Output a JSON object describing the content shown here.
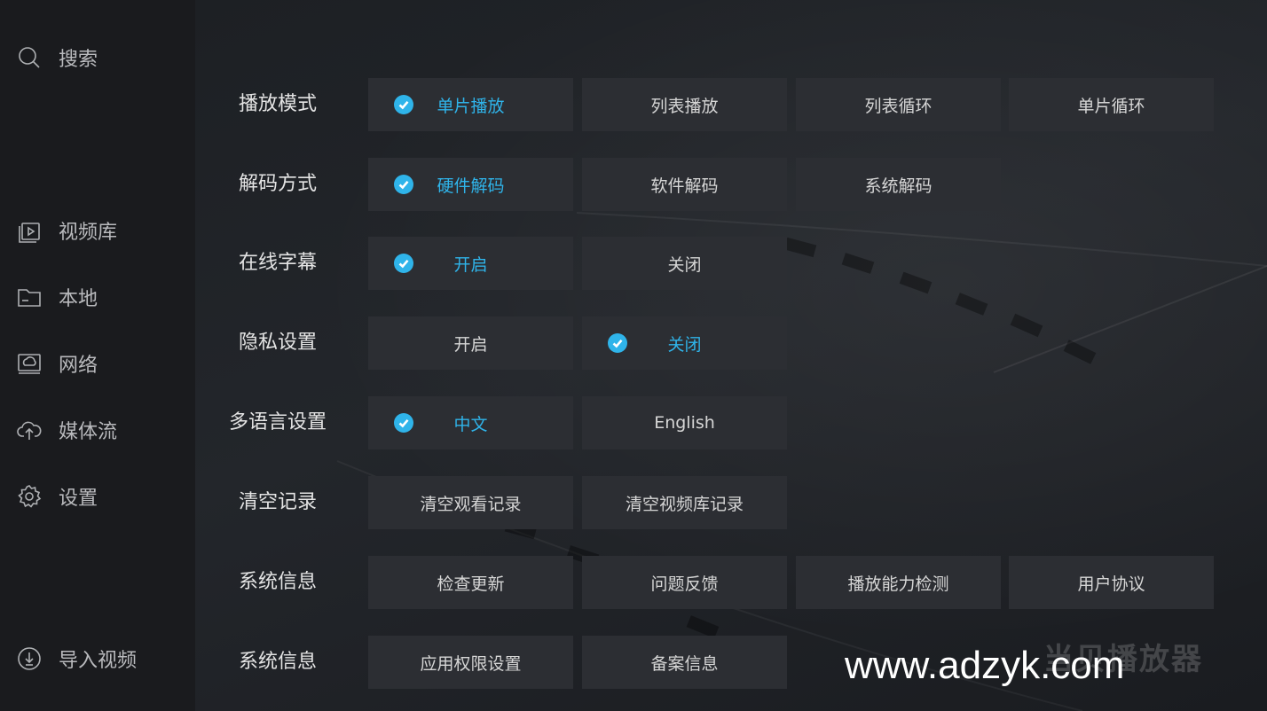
{
  "sidebar": {
    "search": "搜索",
    "items": [
      {
        "label": "视频库",
        "icon": "video-library-icon"
      },
      {
        "label": "本地",
        "icon": "folder-icon"
      },
      {
        "label": "网络",
        "icon": "network-icon"
      },
      {
        "label": "媒体流",
        "icon": "cloud-upload-icon"
      },
      {
        "label": "设置",
        "icon": "gear-icon"
      }
    ],
    "import": "导入视频"
  },
  "settings": [
    {
      "label": "播放模式",
      "options": [
        "单片播放",
        "列表播放",
        "列表循环",
        "单片循环"
      ],
      "selected": 0
    },
    {
      "label": "解码方式",
      "options": [
        "硬件解码",
        "软件解码",
        "系统解码"
      ],
      "selected": 0
    },
    {
      "label": "在线字幕",
      "options": [
        "开启",
        "关闭"
      ],
      "selected": 0
    },
    {
      "label": "隐私设置",
      "options": [
        "开启",
        "关闭"
      ],
      "selected": 1
    },
    {
      "label": "多语言设置",
      "options": [
        "中文",
        "English"
      ],
      "selected": 0
    },
    {
      "label": "清空记录",
      "options": [
        "清空观看记录",
        "清空视频库记录"
      ],
      "selected": -1
    },
    {
      "label": "系统信息",
      "options": [
        "检查更新",
        "问题反馈",
        "播放能力检测",
        "用户协议"
      ],
      "selected": -1
    },
    {
      "label": "系统信息",
      "options": [
        "应用权限设置",
        "备案信息"
      ],
      "selected": -1
    }
  ],
  "watermark": {
    "logo": "当贝播放器",
    "url": "www.adzyk.com"
  },
  "colors": {
    "accent": "#2fb4ea",
    "option_bg": "#2c2e33",
    "background": "#1c1e22"
  }
}
